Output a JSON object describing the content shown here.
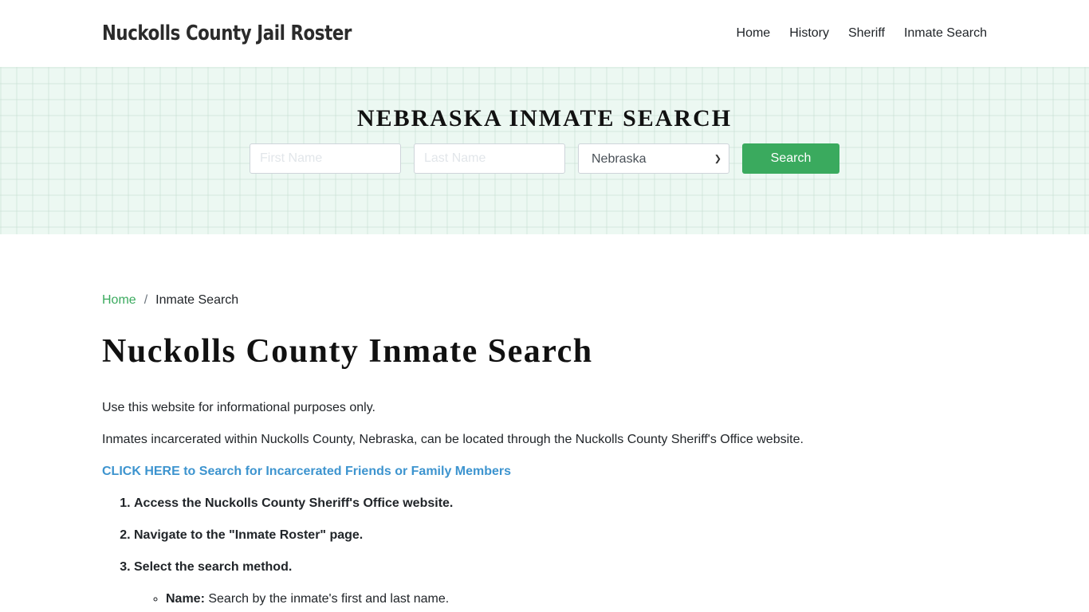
{
  "header": {
    "brand": "Nuckolls County Jail Roster",
    "nav": [
      {
        "label": "Home"
      },
      {
        "label": "History"
      },
      {
        "label": "Sheriff"
      },
      {
        "label": "Inmate Search"
      }
    ]
  },
  "hero": {
    "title": "NEBRASKA INMATE SEARCH",
    "first_name_placeholder": "First Name",
    "last_name_placeholder": "Last Name",
    "state_selected": "Nebraska",
    "search_label": "Search"
  },
  "breadcrumb": {
    "home": "Home",
    "separator": "/",
    "current": "Inmate Search"
  },
  "main": {
    "title": "Nuckolls County Inmate Search",
    "intro": "Use this website for informational purposes only.",
    "description": "Inmates incarcerated within Nuckolls County, Nebraska, can be located through the Nuckolls County Sheriff's Office website.",
    "cta": "CLICK HERE to Search for Incarcerated Friends or Family Members",
    "steps": [
      {
        "text": "Access the Nuckolls County Sheriff's Office website."
      },
      {
        "text": "Navigate to the \"Inmate Roster\" page."
      },
      {
        "text": "Select the search method."
      }
    ],
    "methods": [
      {
        "label": "Name:",
        "text": " Search by the inmate's first and last name."
      }
    ]
  },
  "colors": {
    "accent_green": "#3aaa5e",
    "link_blue": "#3d94cf",
    "hero_bg": "#ecf8f2"
  }
}
